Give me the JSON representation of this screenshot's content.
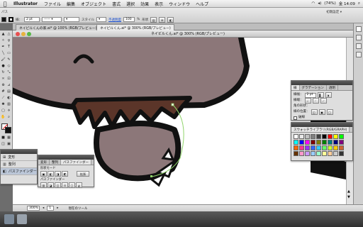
{
  "menubar": {
    "apple": "",
    "app": "Illustrator",
    "items": [
      "ファイル",
      "編集",
      "オブジェクト",
      "書式",
      "選択",
      "効果",
      "表示",
      "ウィンドウ",
      "ヘルプ"
    ],
    "battery": "(74%)",
    "clock": "金 14:09",
    "workspace": "初期設定 ▾"
  },
  "control_bar": {
    "label_path": "パス",
    "stroke_label": "線：",
    "stroke_value": "2 pt",
    "style_label": "スタイル",
    "opacity_label": "不透明度",
    "opacity_value": "100",
    "opacity_unit": "%",
    "shape_label": "形状"
  },
  "document_tabs": [
    {
      "label": "ネイビルくんの家.ai* @ 100% (RGB/プレビュー)",
      "active": false
    },
    {
      "label": "ネイビルくん.ai* @ 300% (RGB/プレビュー)",
      "active": true
    }
  ],
  "window_title": "ネイビルくん.ai* @ 300% (RGB/プレビュー)",
  "status": {
    "zoom": "300%",
    "page": "1",
    "tool": "現在のツール"
  },
  "left_mini_panel": {
    "items": [
      "変形",
      "整列",
      "パスファインダー"
    ],
    "active": "パスファインダー"
  },
  "pathfinder_panel": {
    "tabs": [
      "変形",
      "整列",
      "パスファインダー"
    ],
    "active_tab": "パスファインダー",
    "shape_mode_label": "形状モード",
    "pathfinder_label": "パスファインダー",
    "expand_button": "拡張"
  },
  "stroke_panel": {
    "tabs": [
      "線",
      "グラデーション",
      "透明"
    ],
    "weight_label": "線幅：",
    "weight_value": "2 pt",
    "cap_label": "線端：",
    "corner_label": "角の形状：",
    "align_label": "線の位置：",
    "dashed_label": "破線"
  },
  "swatch_panel": {
    "title": "スウォッチライブラリ(RGB/GRAPH)"
  },
  "colors": {
    "body": "#8c7779",
    "outline": "#111111",
    "tuft": "#5b3529",
    "menubar_bg": "#e6e6e6",
    "panel_bg": "#dedede",
    "claw": "#ffffff",
    "path_highlight": "#8fd46a"
  },
  "swatches": [
    "#ffffff",
    "#e8e8e8",
    "#c0c0c0",
    "#808080",
    "#404040",
    "#000000",
    "#ff0000",
    "#ffff00",
    "#00ff00",
    "#00ffff",
    "#0000ff",
    "#ff00ff",
    "#800000",
    "#808000",
    "#008000",
    "#008080",
    "#000080",
    "#800080",
    "#ff6600",
    "#ff3399",
    "#9933ff",
    "#3366ff",
    "#33ccff",
    "#66ff66",
    "#ccff33",
    "#ffcc00",
    "#cc6633",
    "#663300",
    "#ff99cc",
    "#cc99ff",
    "#99ccff",
    "#99ffcc",
    "#ffff99",
    "#ffcc99",
    "#cccccc",
    "#333333"
  ]
}
